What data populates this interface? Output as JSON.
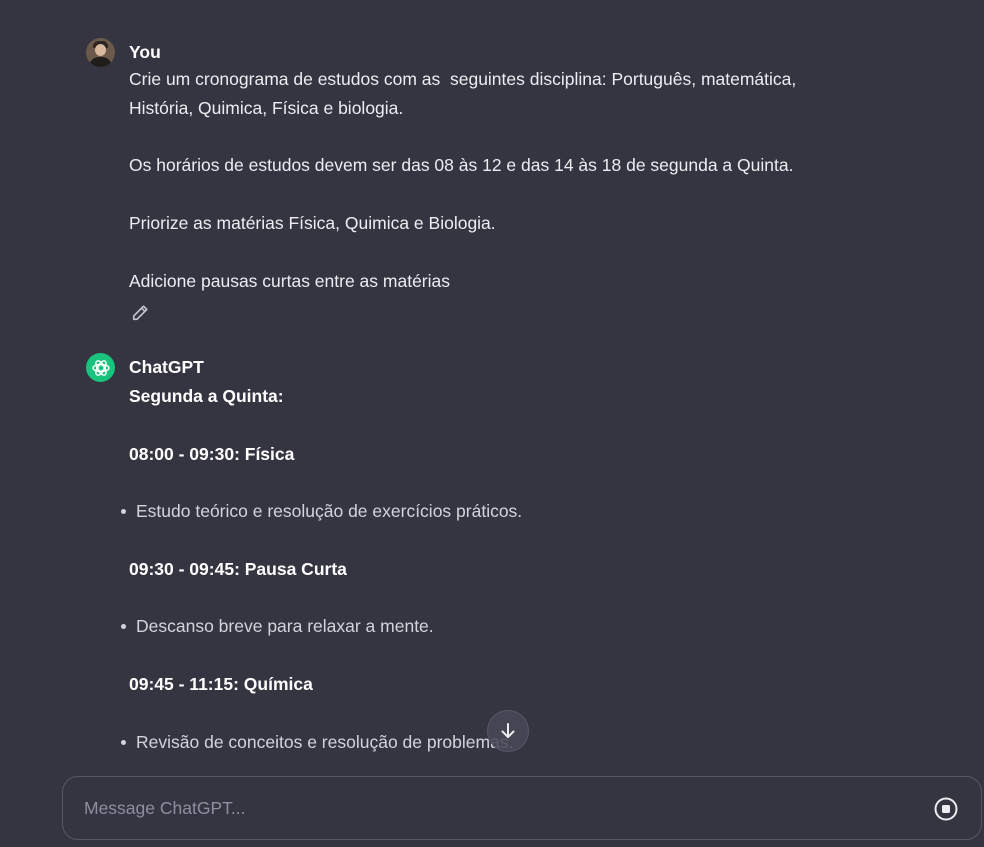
{
  "user_message": {
    "author": "You",
    "lines": [
      "Crie um cronograma de estudos com as  seguintes disciplina: Português, matemática,",
      "História, Quimica, Física e biologia.",
      "",
      "Os horários de estudos devem ser das 08 às 12 e das 14 às 18 de segunda a Quinta.",
      "",
      "Priorize as matérias Física, Quimica e Biologia.",
      "",
      "Adicione pausas curtas entre as matérias"
    ],
    "edit_icon": "pencil-icon"
  },
  "assistant_message": {
    "author": "ChatGPT",
    "heading": "Segunda a Quinta:",
    "blocks": [
      {
        "time": "08:00 - 09:30: Física",
        "bullet": "Estudo teórico e resolução de exercícios práticos."
      },
      {
        "time": "09:30 - 09:45: Pausa Curta",
        "bullet": "Descanso breve para relaxar a mente."
      },
      {
        "time": "09:45 - 11:15: Química",
        "bullet": "Revisão de conceitos e resolução de problemas."
      }
    ]
  },
  "scroll_button_icon": "arrow-down-icon",
  "composer": {
    "placeholder": "Message ChatGPT...",
    "stop_icon": "stop-icon"
  },
  "colors": {
    "background": "#343541",
    "gpt_accent": "#19c37d",
    "border": "#565869"
  }
}
